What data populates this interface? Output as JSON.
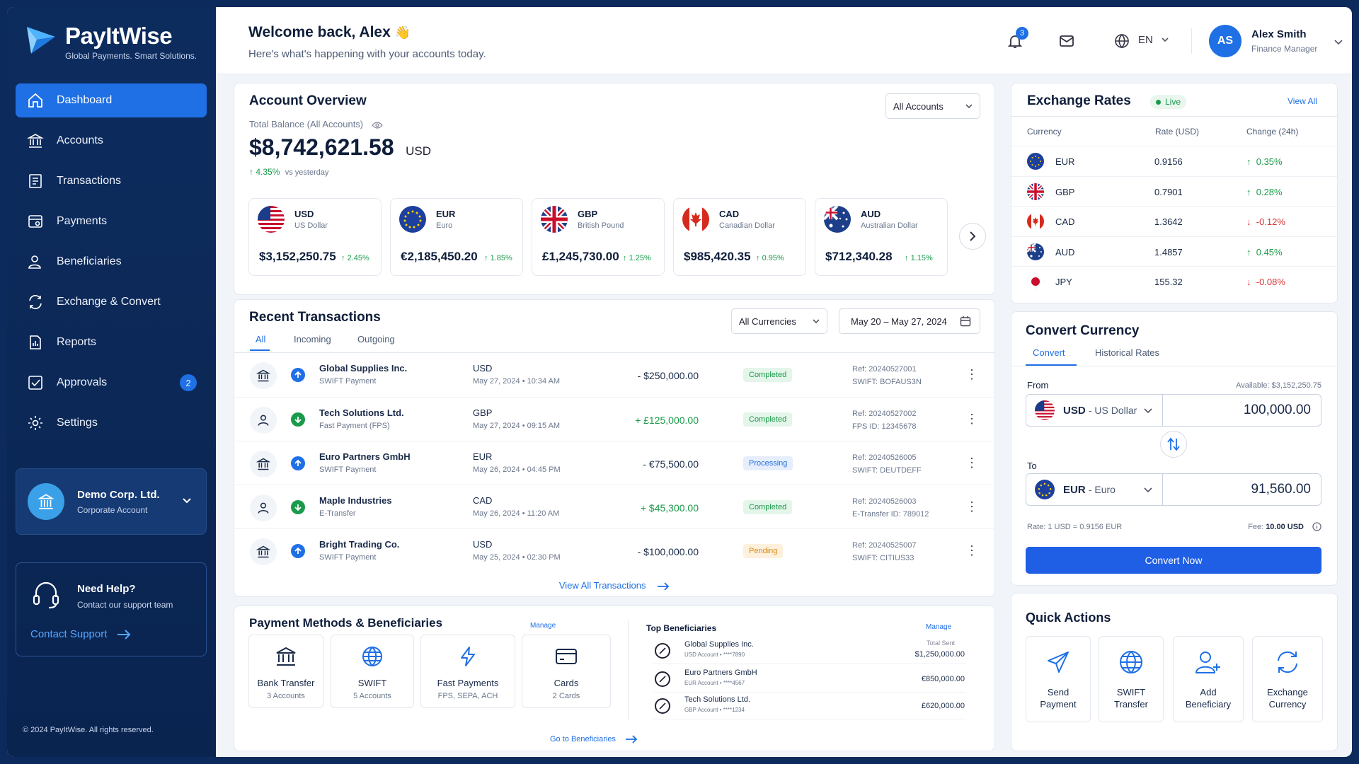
{
  "brand": {
    "name": "PayItWise",
    "tagline": "Global Payments. Smart Solutions."
  },
  "nav": [
    {
      "label": "Dashboard",
      "icon": "home-icon",
      "active": true
    },
    {
      "label": "Accounts",
      "icon": "bank-icon"
    },
    {
      "label": "Transactions",
      "icon": "receipt-icon"
    },
    {
      "label": "Payments",
      "icon": "payment-icon"
    },
    {
      "label": "Beneficiaries",
      "icon": "user-icon"
    },
    {
      "label": "Exchange & Convert",
      "icon": "exchange-icon"
    },
    {
      "label": "Reports",
      "icon": "report-icon"
    },
    {
      "label": "Approvals",
      "icon": "check-icon",
      "badge": "2"
    },
    {
      "label": "Settings",
      "icon": "gear-icon"
    }
  ],
  "org": {
    "name": "Demo Corp. Ltd.",
    "type": "Corporate Account"
  },
  "help": {
    "title": "Need Help?",
    "sub": "Contact our support team",
    "link": "Contact Support"
  },
  "copyright": "© 2024 PayItWise. All rights reserved.",
  "header": {
    "welcome": "Welcome back, Alex",
    "emoji": "👋",
    "sub": "Here's what's happening with your accounts today.",
    "notif_count": "3",
    "lang": "EN",
    "user_initials": "AS",
    "user_name": "Alex Smith",
    "user_role": "Finance Manager"
  },
  "overview": {
    "title": "Account Overview",
    "filter": "All Accounts",
    "balance_label": "Total Balance (All Accounts)",
    "balance": "$8,742,621.58",
    "balance_currency": "USD",
    "change": "4.35%",
    "change_label": "vs yesterday",
    "currencies": [
      {
        "code": "USD",
        "name": "US Dollar",
        "amount": "$3,152,250.75",
        "change": "2.45%"
      },
      {
        "code": "EUR",
        "name": "Euro",
        "amount": "€2,185,450.20",
        "change": "1.85%"
      },
      {
        "code": "GBP",
        "name": "British Pound",
        "amount": "£1,245,730.00",
        "change": "1.25%"
      },
      {
        "code": "CAD",
        "name": "Canadian Dollar",
        "amount": "$985,420.35",
        "change": "0.95%"
      },
      {
        "code": "AUD",
        "name": "Australian Dollar",
        "amount": "$712,340.28",
        "change": "1.15%"
      }
    ]
  },
  "transactions": {
    "title": "Recent Transactions",
    "tabs": [
      "All",
      "Incoming",
      "Outgoing"
    ],
    "filter": "All Currencies",
    "date_range": "May 20 – May 27, 2024",
    "rows": [
      {
        "name": "Global Supplies Inc.",
        "type": "SWIFT Payment",
        "currency": "USD",
        "date": "May 27, 2024  •  10:34 AM",
        "amount": "- $250,000.00",
        "dir": "out",
        "status": "Completed",
        "ref1": "Ref: 20240527001",
        "ref2": "SWIFT: BOFAUS3N",
        "icon": "bank"
      },
      {
        "name": "Tech Solutions Ltd.",
        "type": "Fast Payment (FPS)",
        "currency": "GBP",
        "date": "May 27, 2024  •  09:15 AM",
        "amount": "+ £125,000.00",
        "dir": "in",
        "status": "Completed",
        "ref1": "Ref: 20240527002",
        "ref2": "FPS ID: 12345678",
        "icon": "user"
      },
      {
        "name": "Euro Partners GmbH",
        "type": "SWIFT Payment",
        "currency": "EUR",
        "date": "May 26, 2024  •  04:45 PM",
        "amount": "- €75,500.00",
        "dir": "out",
        "status": "Processing",
        "ref1": "Ref: 20240526005",
        "ref2": "SWIFT: DEUTDEFF",
        "icon": "bank"
      },
      {
        "name": "Maple Industries",
        "type": "E-Transfer",
        "currency": "CAD",
        "date": "May 26, 2024  •  11:20 AM",
        "amount": "+ $45,300.00",
        "dir": "in",
        "status": "Completed",
        "ref1": "Ref: 20240526003",
        "ref2": "E-Transfer ID: 789012",
        "icon": "user"
      },
      {
        "name": "Bright Trading Co.",
        "type": "SWIFT Payment",
        "currency": "USD",
        "date": "May 25, 2024  •  02:30 PM",
        "amount": "- $100,000.00",
        "dir": "out",
        "status": "Pending",
        "ref1": "Ref: 20240525007",
        "ref2": "SWIFT: CITIUS33",
        "icon": "bank"
      }
    ],
    "view_all": "View All Transactions"
  },
  "payment_methods": {
    "title": "Payment Methods & Beneficiaries",
    "manage": "Manage",
    "methods": [
      {
        "label": "Bank Transfer",
        "sub": "3 Accounts"
      },
      {
        "label": "SWIFT",
        "sub": "5 Accounts"
      },
      {
        "label": "Fast Payments",
        "sub": "FPS, SEPA, ACH"
      },
      {
        "label": "Cards",
        "sub": "2 Cards"
      }
    ],
    "top_title": "Top Beneficiaries",
    "top_manage": "Manage",
    "total_sent": "Total Sent",
    "beneficiaries": [
      {
        "name": "Global Supplies Inc.",
        "account": "USD Account  •  ****7890",
        "amount": "$1,250,000.00"
      },
      {
        "name": "Euro Partners GmbH",
        "account": "EUR Account  •  ****4567",
        "amount": "€850,000.00"
      },
      {
        "name": "Tech Solutions Ltd.",
        "account": "GBP Account  •  ****1234",
        "amount": "£620,000.00"
      }
    ],
    "goto": "Go to Beneficiaries"
  },
  "exchange": {
    "title": "Exchange Rates",
    "live": "Live",
    "view_all": "View All",
    "headers": [
      "Currency",
      "Rate (USD)",
      "Change (24h)"
    ],
    "rows": [
      {
        "code": "EUR",
        "rate": "0.9156",
        "change": "0.35%",
        "dir": "up"
      },
      {
        "code": "GBP",
        "rate": "0.7901",
        "change": "0.28%",
        "dir": "up"
      },
      {
        "code": "CAD",
        "rate": "1.3642",
        "change": "-0.12%",
        "dir": "down"
      },
      {
        "code": "AUD",
        "rate": "1.4857",
        "change": "0.45%",
        "dir": "up"
      },
      {
        "code": "JPY",
        "rate": "155.32",
        "change": "-0.08%",
        "dir": "down"
      }
    ]
  },
  "convert": {
    "title": "Convert Currency",
    "tabs": [
      "Convert",
      "Historical Rates"
    ],
    "from_label": "From",
    "available": "Available: $3,152,250.75",
    "from_code": "USD",
    "from_name": "- US Dollar",
    "from_value": "100,000.00",
    "to_label": "To",
    "to_code": "EUR",
    "to_name": "- Euro",
    "to_value": "91,560.00",
    "rate": "Rate: 1 USD = 0.9156 EUR",
    "fee_label": "Fee:",
    "fee": "10.00 USD",
    "button": "Convert Now"
  },
  "quick_actions": {
    "title": "Quick Actions",
    "items": [
      {
        "line1": "Send",
        "line2": "Payment",
        "icon": "send-icon"
      },
      {
        "line1": "SWIFT",
        "line2": "Transfer",
        "icon": "globe-icon"
      },
      {
        "line1": "Add",
        "line2": "Beneficiary",
        "icon": "add-user-icon"
      },
      {
        "line1": "Exchange",
        "line2": "Currency",
        "icon": "refresh-icon"
      }
    ]
  },
  "colors": {
    "accent": "#1f6fe5",
    "sidebar": "#0d2c5e",
    "positive": "#1a9a4a",
    "negative": "#d93434",
    "pending": "#d98a12"
  }
}
